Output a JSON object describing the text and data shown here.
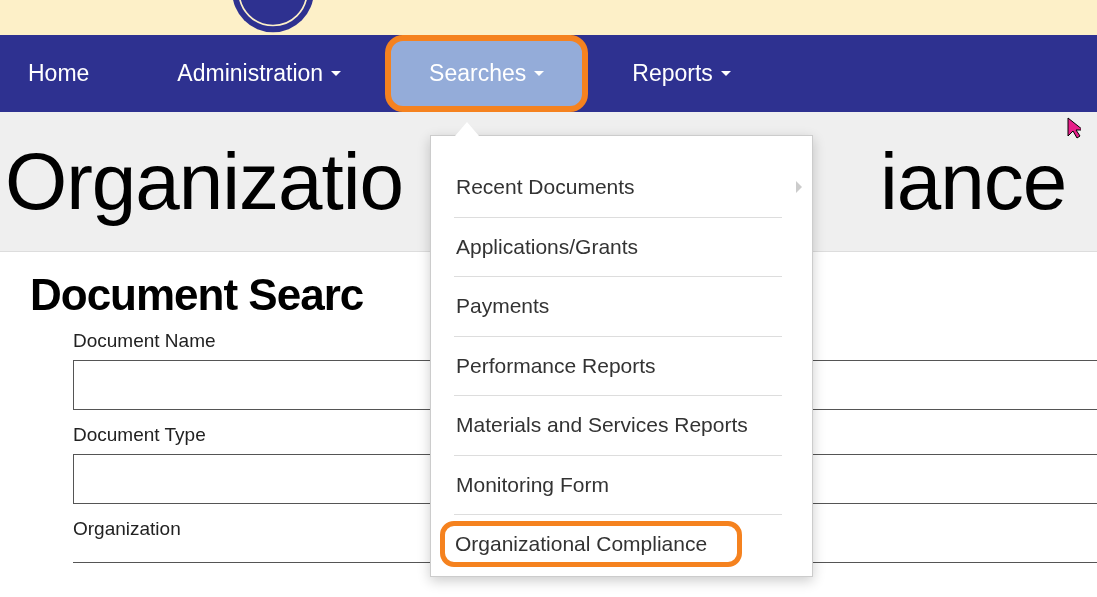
{
  "nav": [
    {
      "label": "Home",
      "has_menu": false,
      "selected": false
    },
    {
      "label": "Administration",
      "has_menu": true,
      "selected": false
    },
    {
      "label": "Searches",
      "has_menu": true,
      "selected": true
    },
    {
      "label": "Reports",
      "has_menu": true,
      "selected": false
    }
  ],
  "page_title": {
    "visible_start": "Organizatio",
    "visible_end": "iance"
  },
  "section_title": "Document Searc",
  "form": [
    {
      "label": "Document Name",
      "kind": "input"
    },
    {
      "label": "Document Type",
      "kind": "input"
    },
    {
      "label": "Organization",
      "kind": "line"
    }
  ],
  "dropdown": [
    {
      "label": "Recent Documents",
      "submenu": true,
      "selected": false
    },
    {
      "label": "Applications/Grants",
      "submenu": false,
      "selected": false
    },
    {
      "label": "Payments",
      "submenu": false,
      "selected": false
    },
    {
      "label": "Performance Reports",
      "submenu": false,
      "selected": false
    },
    {
      "label": "Materials and Services Reports",
      "submenu": false,
      "selected": false
    },
    {
      "label": "Monitoring Form",
      "submenu": false,
      "selected": false
    },
    {
      "label": "Organizational Compliance",
      "submenu": false,
      "selected": true
    }
  ]
}
